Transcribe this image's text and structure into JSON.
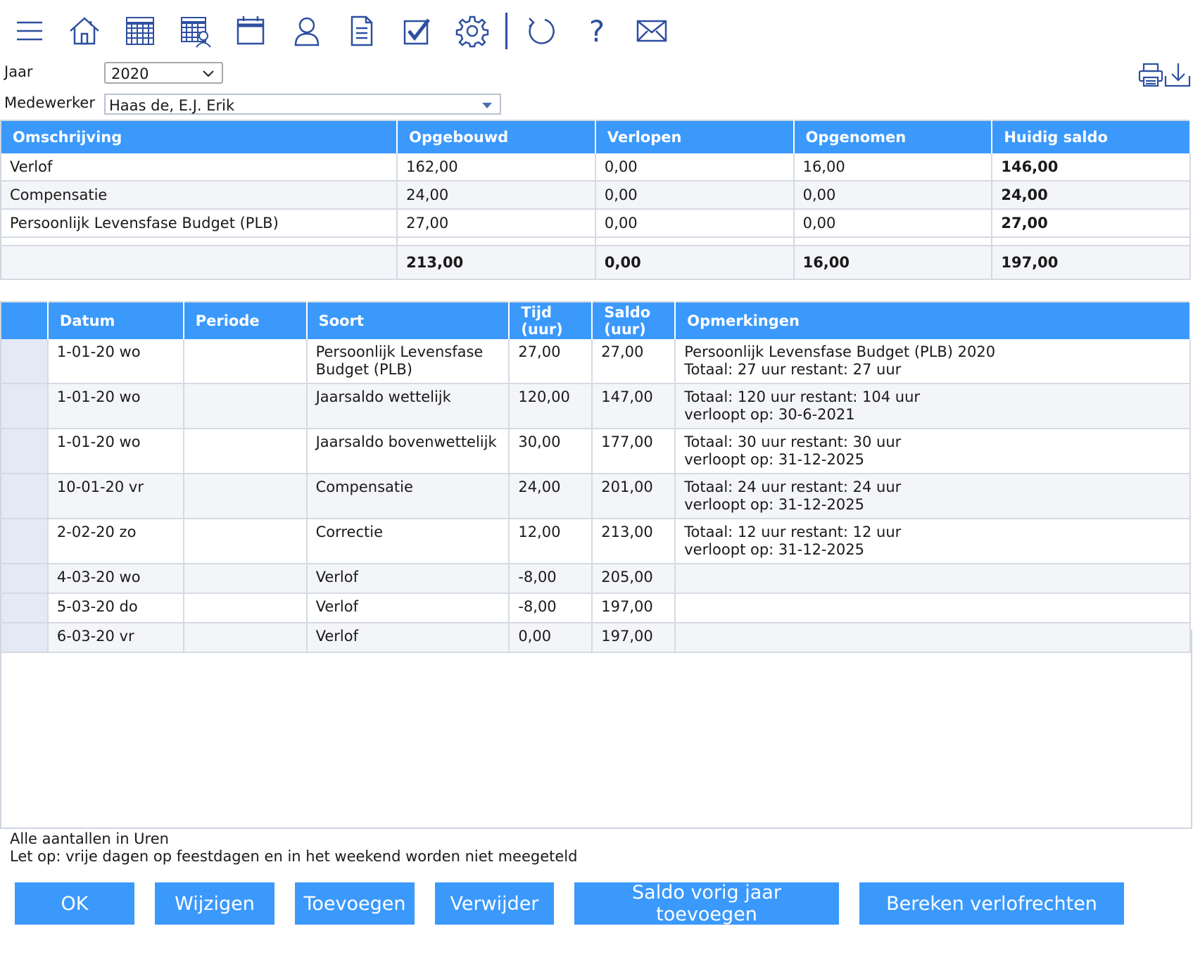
{
  "toolbar": {
    "icons": [
      "menu-icon",
      "home-icon",
      "calendar-grid-icon",
      "schedule-person-icon",
      "calendar-icon",
      "user-icon",
      "document-icon",
      "checkbox-icon",
      "settings-icon",
      "refresh-icon",
      "help-icon",
      "mail-icon"
    ],
    "help_glyph": "?",
    "accent": "#2d4fa0"
  },
  "filters": {
    "year_label": "Jaar",
    "year_value": "2020",
    "employee_label": "Medewerker",
    "employee_value": "Haas de, E.J. Erik"
  },
  "summary": {
    "headers": [
      "Omschrijving",
      "Opgebouwd",
      "Verlopen",
      "Opgenomen",
      "Huidig saldo"
    ],
    "rows": [
      [
        "Verlof",
        "162,00",
        "0,00",
        "16,00",
        "146,00"
      ],
      [
        "Compensatie",
        "24,00",
        "0,00",
        "0,00",
        "24,00"
      ],
      [
        "Persoonlijk Levensfase Budget (PLB)",
        "27,00",
        "0,00",
        "0,00",
        "27,00"
      ]
    ],
    "total": [
      "",
      "213,00",
      "0,00",
      "16,00",
      "197,00"
    ]
  },
  "mutations": {
    "headers": {
      "datum": "Datum",
      "periode": "Periode",
      "soort": "Soort",
      "tijd_1": "Tijd",
      "tijd_2": "(uur)",
      "saldo_1": "Saldo",
      "saldo_2": "(uur)",
      "opmerkingen": "Opmerkingen"
    },
    "rows": [
      {
        "datum": "1-01-20 wo",
        "periode": "",
        "soort_1": "Persoonlijk Levensfase",
        "soort_2": "Budget (PLB)",
        "tijd": "27,00",
        "saldo": "27,00",
        "opm_1": "Persoonlijk Levensfase Budget (PLB) 2020",
        "opm_2": "Totaal: 27 uur restant: 27 uur"
      },
      {
        "datum": "1-01-20 wo",
        "periode": "",
        "soort_1": "Jaarsaldo wettelijk",
        "soort_2": "",
        "tijd": "120,00",
        "saldo": "147,00",
        "opm_1": "Totaal: 120 uur restant: 104 uur",
        "opm_2": "verloopt op: 30-6-2021"
      },
      {
        "datum": "1-01-20 wo",
        "periode": "",
        "soort_1": "Jaarsaldo bovenwettelijk",
        "soort_2": "",
        "tijd": "30,00",
        "saldo": "177,00",
        "opm_1": "Totaal: 30 uur restant: 30 uur",
        "opm_2": "verloopt op: 31-12-2025"
      },
      {
        "datum": "10-01-20 vr",
        "periode": "",
        "soort_1": "Compensatie",
        "soort_2": "",
        "tijd": "24,00",
        "saldo": "201,00",
        "opm_1": "Totaal: 24 uur restant: 24 uur",
        "opm_2": "verloopt op: 31-12-2025"
      },
      {
        "datum": "2-02-20 zo",
        "periode": "",
        "soort_1": "Correctie",
        "soort_2": "",
        "tijd": "12,00",
        "saldo": "213,00",
        "opm_1": "Totaal: 12 uur restant: 12 uur",
        "opm_2": "verloopt op: 31-12-2025"
      },
      {
        "datum": "4-03-20 wo",
        "periode": "",
        "soort_1": "Verlof",
        "soort_2": "",
        "tijd": "-8,00",
        "saldo": "205,00",
        "opm_1": "",
        "opm_2": ""
      },
      {
        "datum": "5-03-20 do",
        "periode": "",
        "soort_1": "Verlof",
        "soort_2": "",
        "tijd": "-8,00",
        "saldo": "197,00",
        "opm_1": "",
        "opm_2": ""
      },
      {
        "datum": "6-03-20 vr",
        "periode": "",
        "soort_1": "Verlof",
        "soort_2": "",
        "tijd": "0,00",
        "saldo": "197,00",
        "opm_1": "",
        "opm_2": ""
      }
    ]
  },
  "notes": {
    "line1": "Alle aantallen in Uren",
    "line2": "Let op: vrije dagen op feestdagen en in het weekend worden niet meegeteld"
  },
  "buttons": {
    "ok": "OK",
    "edit": "Wijzigen",
    "add": "Toevoegen",
    "delete": "Verwijder",
    "add_prev_balance": "Saldo vorig jaar toevoegen",
    "calculate": "Bereken verlofrechten"
  },
  "colors": {
    "header_blue": "#3b99fc",
    "icon_blue": "#2d4fa0"
  }
}
